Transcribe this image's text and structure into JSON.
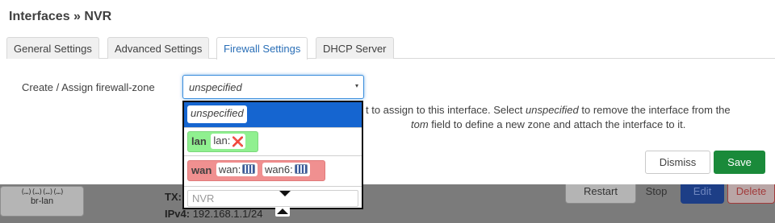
{
  "background": {
    "interface_name": "br-lan",
    "interface_ports": "(…)(…)(…)(…)",
    "tx_label": "TX:",
    "ipv4_label": "IPv4:",
    "ipv4_value": "192.168.1.1/24",
    "buttons": [
      "Restart",
      "Stop",
      "Edit",
      "Delete"
    ]
  },
  "modal": {
    "title": "Interfaces » NVR",
    "tabs": [
      {
        "label": "General Settings",
        "active": false
      },
      {
        "label": "Advanced Settings",
        "active": false
      },
      {
        "label": "Firewall Settings",
        "active": true
      },
      {
        "label": "DHCP Server",
        "active": false
      }
    ],
    "field_label": "Create / Assign firewall-zone",
    "select_value": "unspecified",
    "help": {
      "line1_a": "t to assign to this interface. Select ",
      "line1_em": "unspecified",
      "line1_b": " to remove the interface from the",
      "line2_em": "tom",
      "line2_b": " field to define a new zone and attach the interface to it."
    },
    "dismiss_label": "Dismiss",
    "save_label": "Save"
  },
  "dropdown": {
    "options": [
      {
        "label": "unspecified",
        "selected": true
      },
      {
        "zone": "lan",
        "color": "#90f090",
        "interfaces": [
          "lan:"
        ]
      },
      {
        "zone": "wan",
        "color": "#f09090",
        "interfaces": [
          "wan:",
          "wan6:"
        ]
      }
    ],
    "custom_placeholder": "NVR"
  },
  "colors": {
    "accent": "#2a6fb7",
    "selected_option": "#1565d0",
    "save_button": "#1a8a3a",
    "lan_zone": "#90f090",
    "wan_zone": "#f09090"
  }
}
